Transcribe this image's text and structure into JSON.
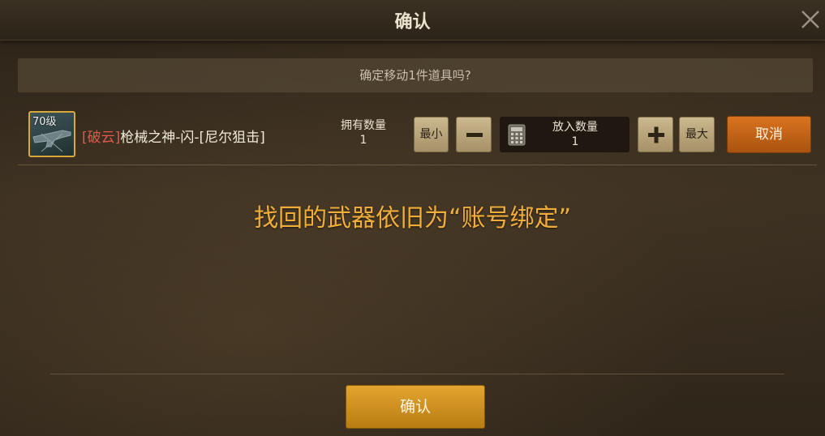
{
  "dialog": {
    "title": "确认",
    "close_icon": "close-icon"
  },
  "prompt": {
    "text": "确定移动1件道具吗?"
  },
  "item": {
    "level": "70级",
    "name_prefix": "[破云]",
    "name_main": "枪械之神-闪-[尼尔狙击]",
    "owned_label": "拥有数量",
    "owned_value": "1"
  },
  "quantity": {
    "min_label": "最小",
    "minus_icon": "minus-icon",
    "calculator_icon": "calculator-icon",
    "put_label": "放入数量",
    "put_value": "1",
    "plus_icon": "plus-icon",
    "max_label": "最大"
  },
  "buttons": {
    "cancel_label": "取消",
    "confirm_label": "确认"
  },
  "notice": {
    "text": "找回的武器依旧为“账号绑定”"
  },
  "colors": {
    "prefix_red": "#e05a4d",
    "notice_orange": "#f0ad3a",
    "cancel_orange": "#d9731f",
    "confirm_gold": "#e3a52f"
  }
}
